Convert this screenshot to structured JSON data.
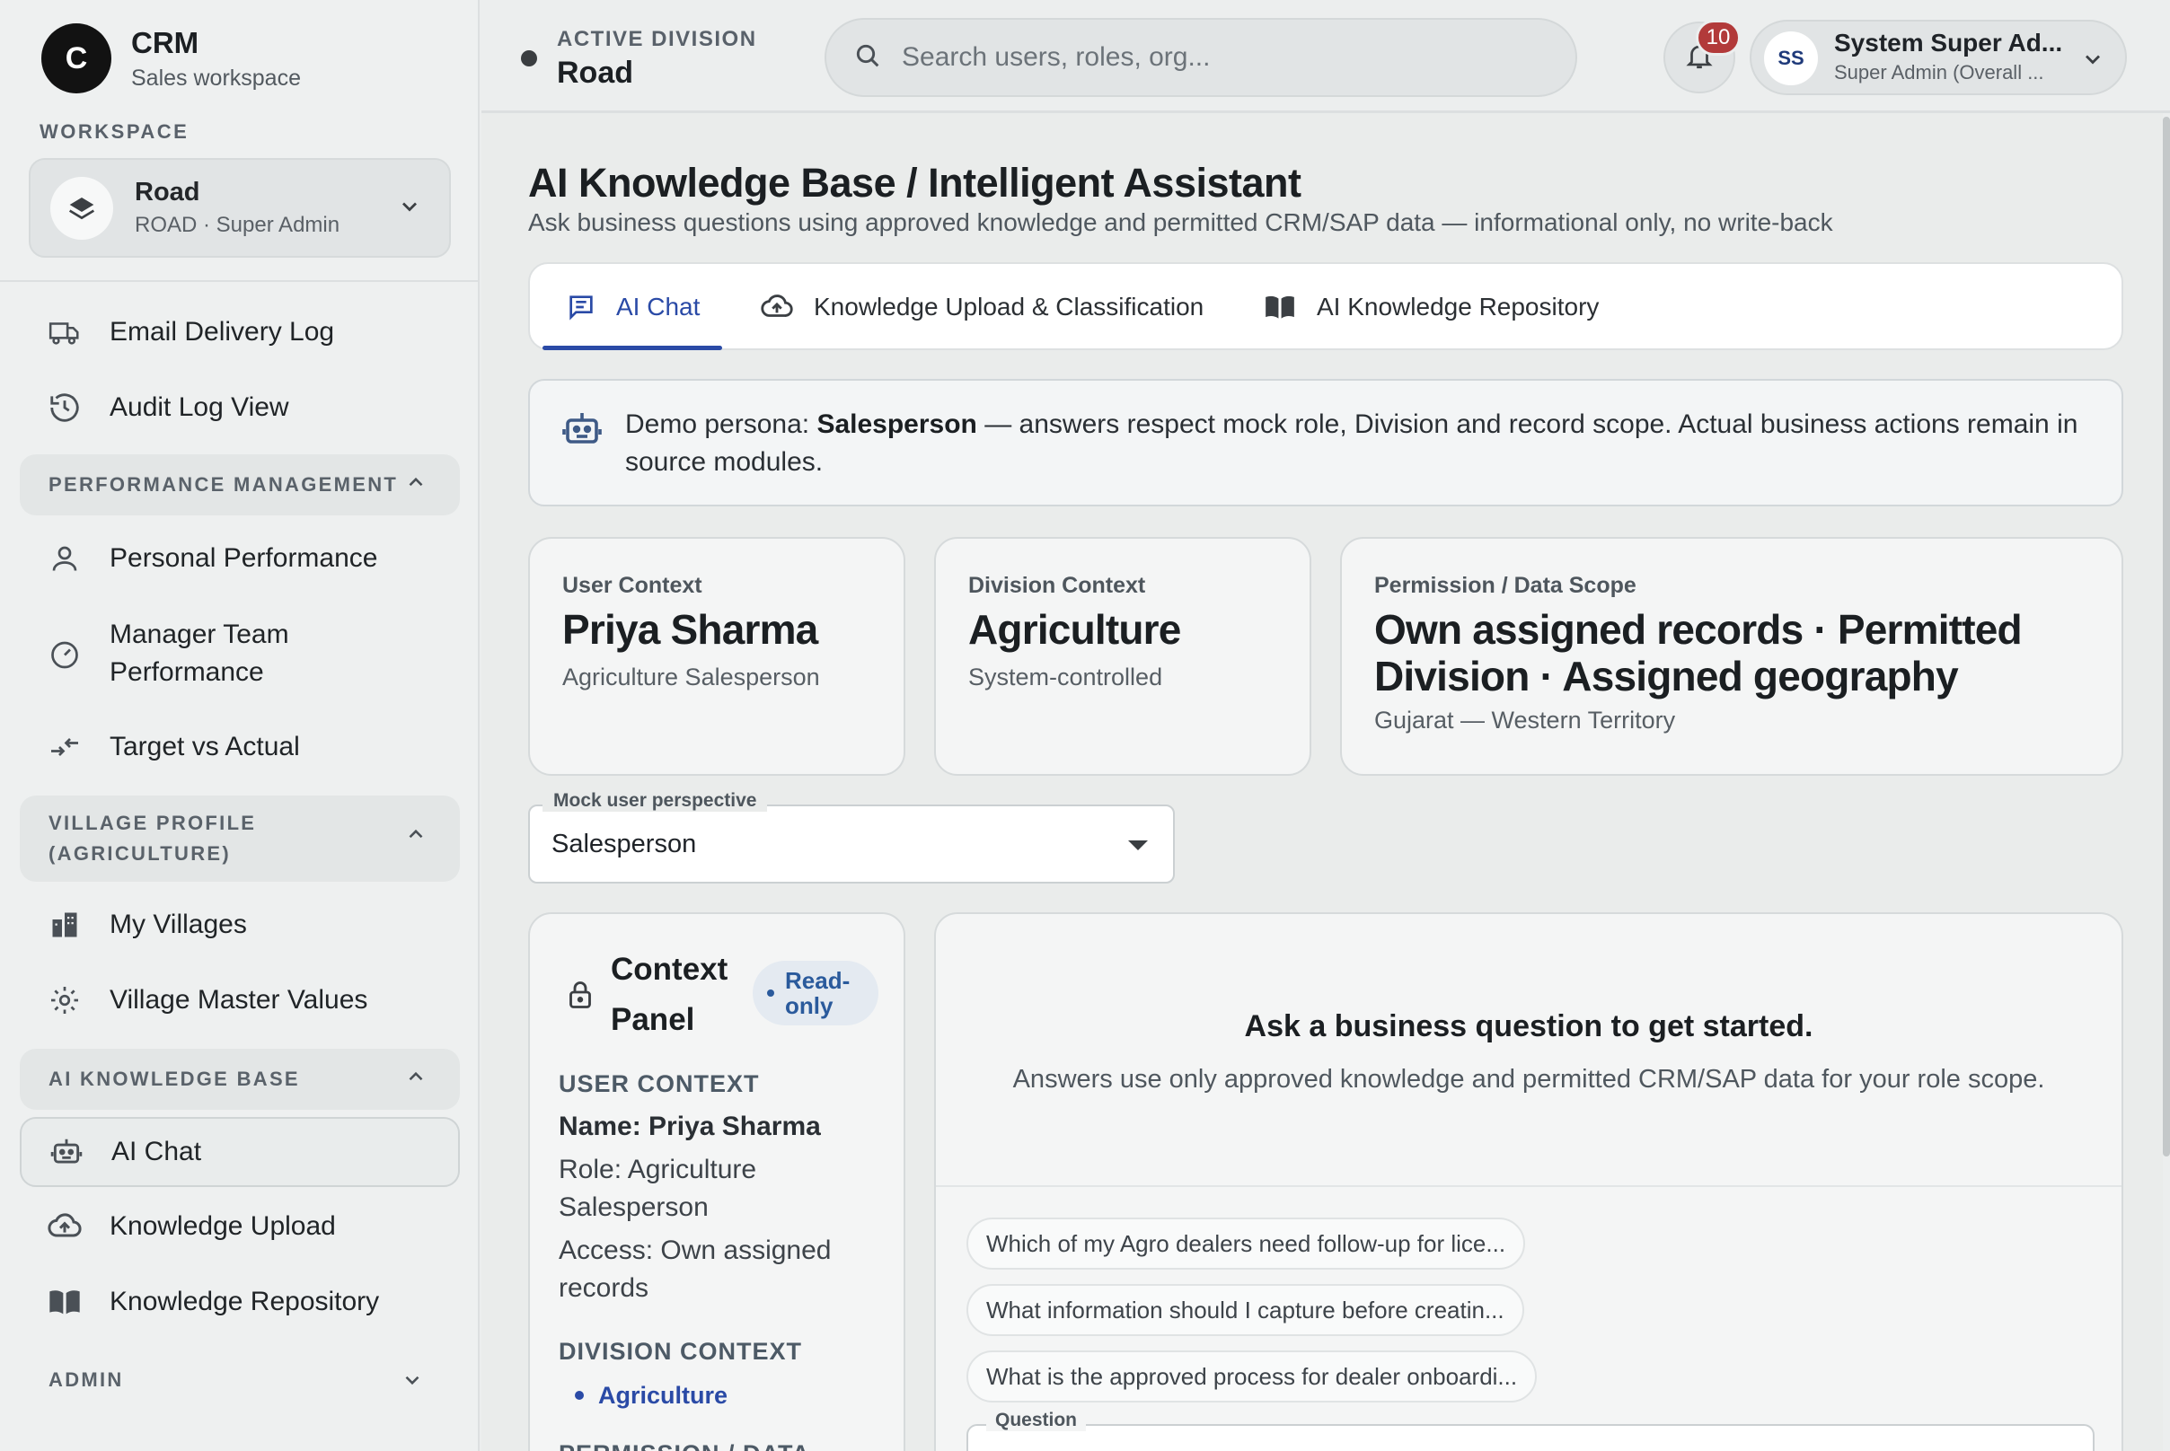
{
  "sidebar": {
    "brand": {
      "logo_letter": "C",
      "name": "CRM",
      "subtitle": "Sales workspace"
    },
    "workspace_label": "WORKSPACE",
    "workspace": {
      "name": "Road",
      "subtitle": "ROAD · Super Admin"
    },
    "items_top": [
      {
        "label": "Email Delivery Log",
        "icon": "truck-icon"
      },
      {
        "label": "Audit Log View",
        "icon": "history-icon"
      }
    ],
    "sections": {
      "performance": "PERFORMANCE MANAGEMENT",
      "village": "VILLAGE PROFILE (AGRICULTURE)",
      "ai": "AI KNOWLEDGE BASE",
      "admin": "ADMIN"
    },
    "performance_items": [
      {
        "label": "Personal Performance",
        "icon": "person-icon"
      },
      {
        "label": "Manager Team Performance",
        "icon": "speedometer-icon"
      },
      {
        "label": "Target vs Actual",
        "icon": "compare-arrows-icon"
      }
    ],
    "village_items": [
      {
        "label": "My Villages",
        "icon": "buildings-icon"
      },
      {
        "label": "Village Master Values",
        "icon": "gear-icon"
      }
    ],
    "ai_items": [
      {
        "label": "AI Chat",
        "icon": "robot-icon"
      },
      {
        "label": "Knowledge Upload",
        "icon": "cloud-upload-icon"
      },
      {
        "label": "Knowledge Repository",
        "icon": "book-icon"
      }
    ]
  },
  "topbar": {
    "division_label": "ACTIVE DIVISION",
    "division_name": "Road",
    "search_placeholder": "Search users, roles, org...",
    "notifications_count": "10",
    "user": {
      "initials": "SS",
      "name": "System Super Ad...",
      "role": "Super Admin (Overall ..."
    }
  },
  "page": {
    "title": "AI Knowledge Base / Intelligent Assistant",
    "subtitle": "Ask business questions using approved knowledge and permitted CRM/SAP data — informational only, no write-back"
  },
  "tabs": [
    {
      "label": "AI Chat",
      "icon": "chat-icon",
      "active": true
    },
    {
      "label": "Knowledge Upload & Classification",
      "icon": "cloud-upload-icon",
      "active": false
    },
    {
      "label": "AI Knowledge Repository",
      "icon": "book-icon",
      "active": false
    }
  ],
  "info": {
    "prefix": "Demo persona: ",
    "persona": "Salesperson",
    "suffix": " — answers respect mock role, Division and record scope. Actual business actions remain in source modules."
  },
  "context_cards": {
    "user": {
      "label": "User Context",
      "value": "Priya Sharma",
      "sub": "Agriculture Salesperson"
    },
    "division": {
      "label": "Division Context",
      "value": "Agriculture",
      "sub": "System-controlled"
    },
    "permission": {
      "label": "Permission / Data Scope",
      "value": "Own assigned records · Permitted Division · Assigned geography",
      "sub": "Gujarat — Western Territory"
    }
  },
  "perspective": {
    "label": "Mock user perspective",
    "value": "Salesperson"
  },
  "context_panel": {
    "title": "Context Panel",
    "badge": "Read-only",
    "user_heading": "USER CONTEXT",
    "name_label": "Name: ",
    "name_value": "Priya Sharma",
    "role_line": "Role: Agriculture Salesperson",
    "access_line": "Access: Own assigned records",
    "division_heading": "DIVISION CONTEXT",
    "division_chip": "Agriculture",
    "permission_heading": "PERMISSION / DATA"
  },
  "chat": {
    "heading": "Ask a business question to get started.",
    "subheading": "Answers use only approved knowledge and permitted CRM/SAP data for your role scope.",
    "suggestions": [
      "Which of my Agro dealers need follow-up for lice...",
      "What information should I capture before creatin...",
      "What is the approved process for dealer onboardi..."
    ],
    "question_label": "Question"
  },
  "colors": {
    "accent": "#2a4aa6",
    "badge": "#b23a3a",
    "logo": "#121212"
  }
}
